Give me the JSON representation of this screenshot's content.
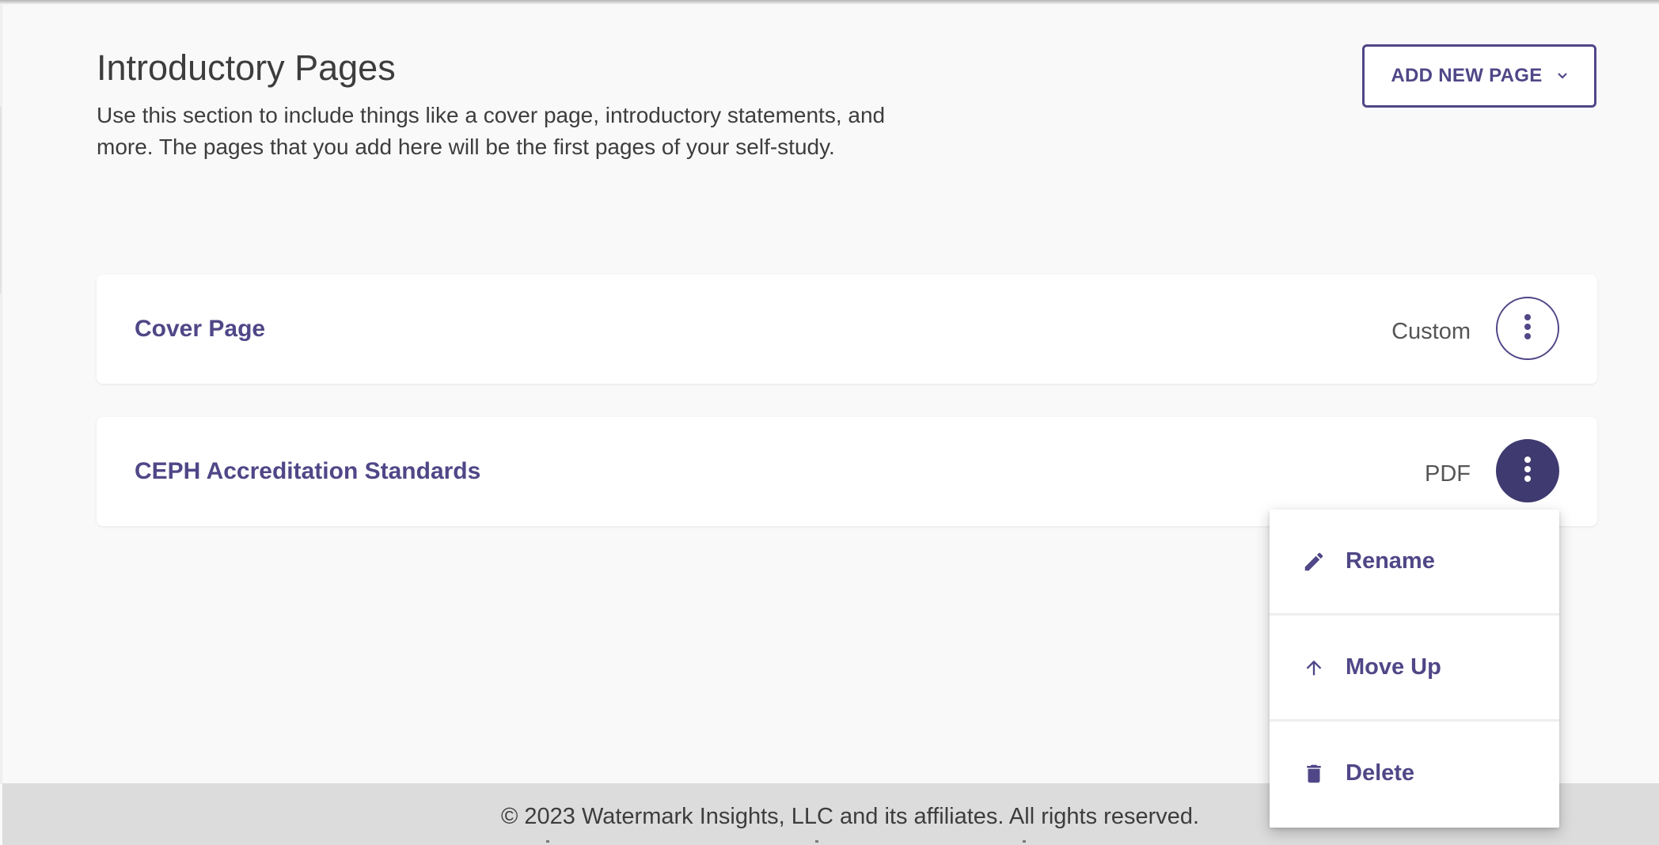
{
  "header": {
    "title": "Introductory Pages",
    "description": "Use this section to include things like a cover page, introductory statements, and more. The pages that you add here will be the first pages of your self-study.",
    "add_button_label": "ADD NEW PAGE"
  },
  "pages": [
    {
      "title": "Cover Page",
      "type": "Custom"
    },
    {
      "title": "CEPH Accreditation Standards",
      "type": "PDF"
    }
  ],
  "context_menu": {
    "items": [
      {
        "label": "Rename",
        "icon": "pencil-icon"
      },
      {
        "label": "Move Up",
        "icon": "arrow-up-icon"
      },
      {
        "label": "Delete",
        "icon": "trash-icon"
      }
    ]
  },
  "footer": {
    "copyright": "© 2023 Watermark Insights, LLC and its affiliates. All rights reserved."
  },
  "colors": {
    "accent": "#4f4787",
    "accent_dark": "#3f3a6f",
    "background": "#f9f9f9",
    "card": "#ffffff",
    "footer": "#dcdcdc",
    "text": "#3d3d3d"
  }
}
